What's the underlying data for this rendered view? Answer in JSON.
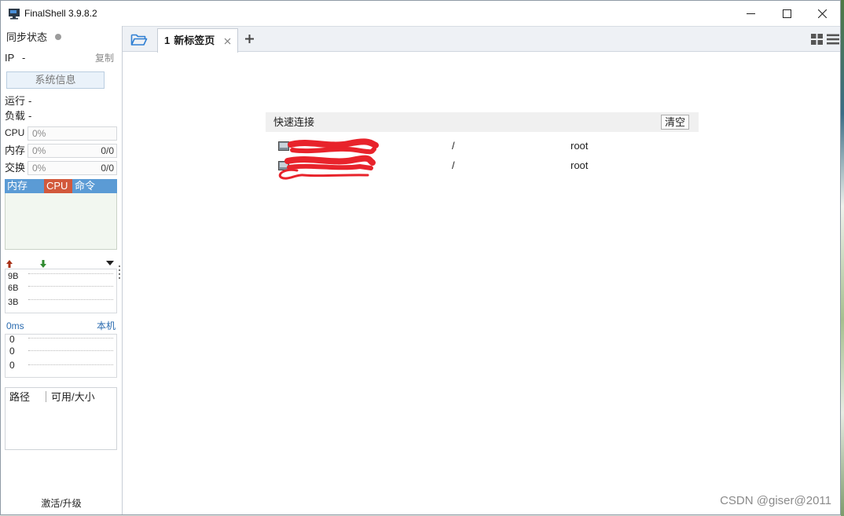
{
  "window": {
    "title": "FinalShell 3.9.8.2",
    "icons": {
      "app": "finalshell-app-icon",
      "minimize": "minimize-icon",
      "maximize": "maximize-icon",
      "close": "close-icon"
    }
  },
  "sidebar": {
    "sync_status": {
      "label": "同步状态",
      "indicator_color": "#9c9c9c"
    },
    "ip": {
      "label": "IP",
      "value": "-",
      "copy_label": "复制"
    },
    "sysinfo_button": "系统信息",
    "uptime": {
      "label": "运行",
      "value": "-"
    },
    "load": {
      "label": "负载",
      "value": "-"
    },
    "cpu": {
      "label": "CPU",
      "percent": "0%"
    },
    "memory": {
      "label": "内存",
      "percent": "0%",
      "usage": "0/0"
    },
    "swap": {
      "label": "交换",
      "percent": "0%",
      "usage": "0/0"
    },
    "process_tabs": [
      {
        "label": "内存",
        "color": "#5b9bd5"
      },
      {
        "label": "CPU",
        "color": "#d2593c"
      },
      {
        "label": "命令",
        "color": "#5b9bd5"
      }
    ],
    "network": {
      "scale": [
        "9B",
        "6B",
        "3B"
      ],
      "upload_color": "#a83217",
      "download_color": "#2f8a2f",
      "icons": [
        "upload-arrow-icon",
        "download-arrow-icon",
        "dropdown-triangle-icon"
      ]
    },
    "latency": {
      "value": "0ms",
      "host": "本机",
      "scale": [
        "0",
        "0",
        "0"
      ]
    },
    "disk_table": {
      "columns": [
        "路径",
        "可用/大小"
      ]
    },
    "activate_label": "激活/升级"
  },
  "main": {
    "toolbar_icons": [
      "folder-icon",
      "plus-icon",
      "grid-view-icon",
      "list-view-icon"
    ],
    "tabs": [
      {
        "index": "1",
        "label": "新标签页"
      }
    ],
    "quick_connect": {
      "title": "快速连接",
      "clear_label": "清空",
      "rows": [
        {
          "path": "/",
          "user": "root"
        },
        {
          "path": "/",
          "user": "root"
        }
      ]
    },
    "watermark": "CSDN @giser@2011"
  },
  "colors": {
    "link_blue": "#2b6cb0",
    "folder_blue": "#2f7fd3",
    "redaction_red": "#e8232b"
  }
}
